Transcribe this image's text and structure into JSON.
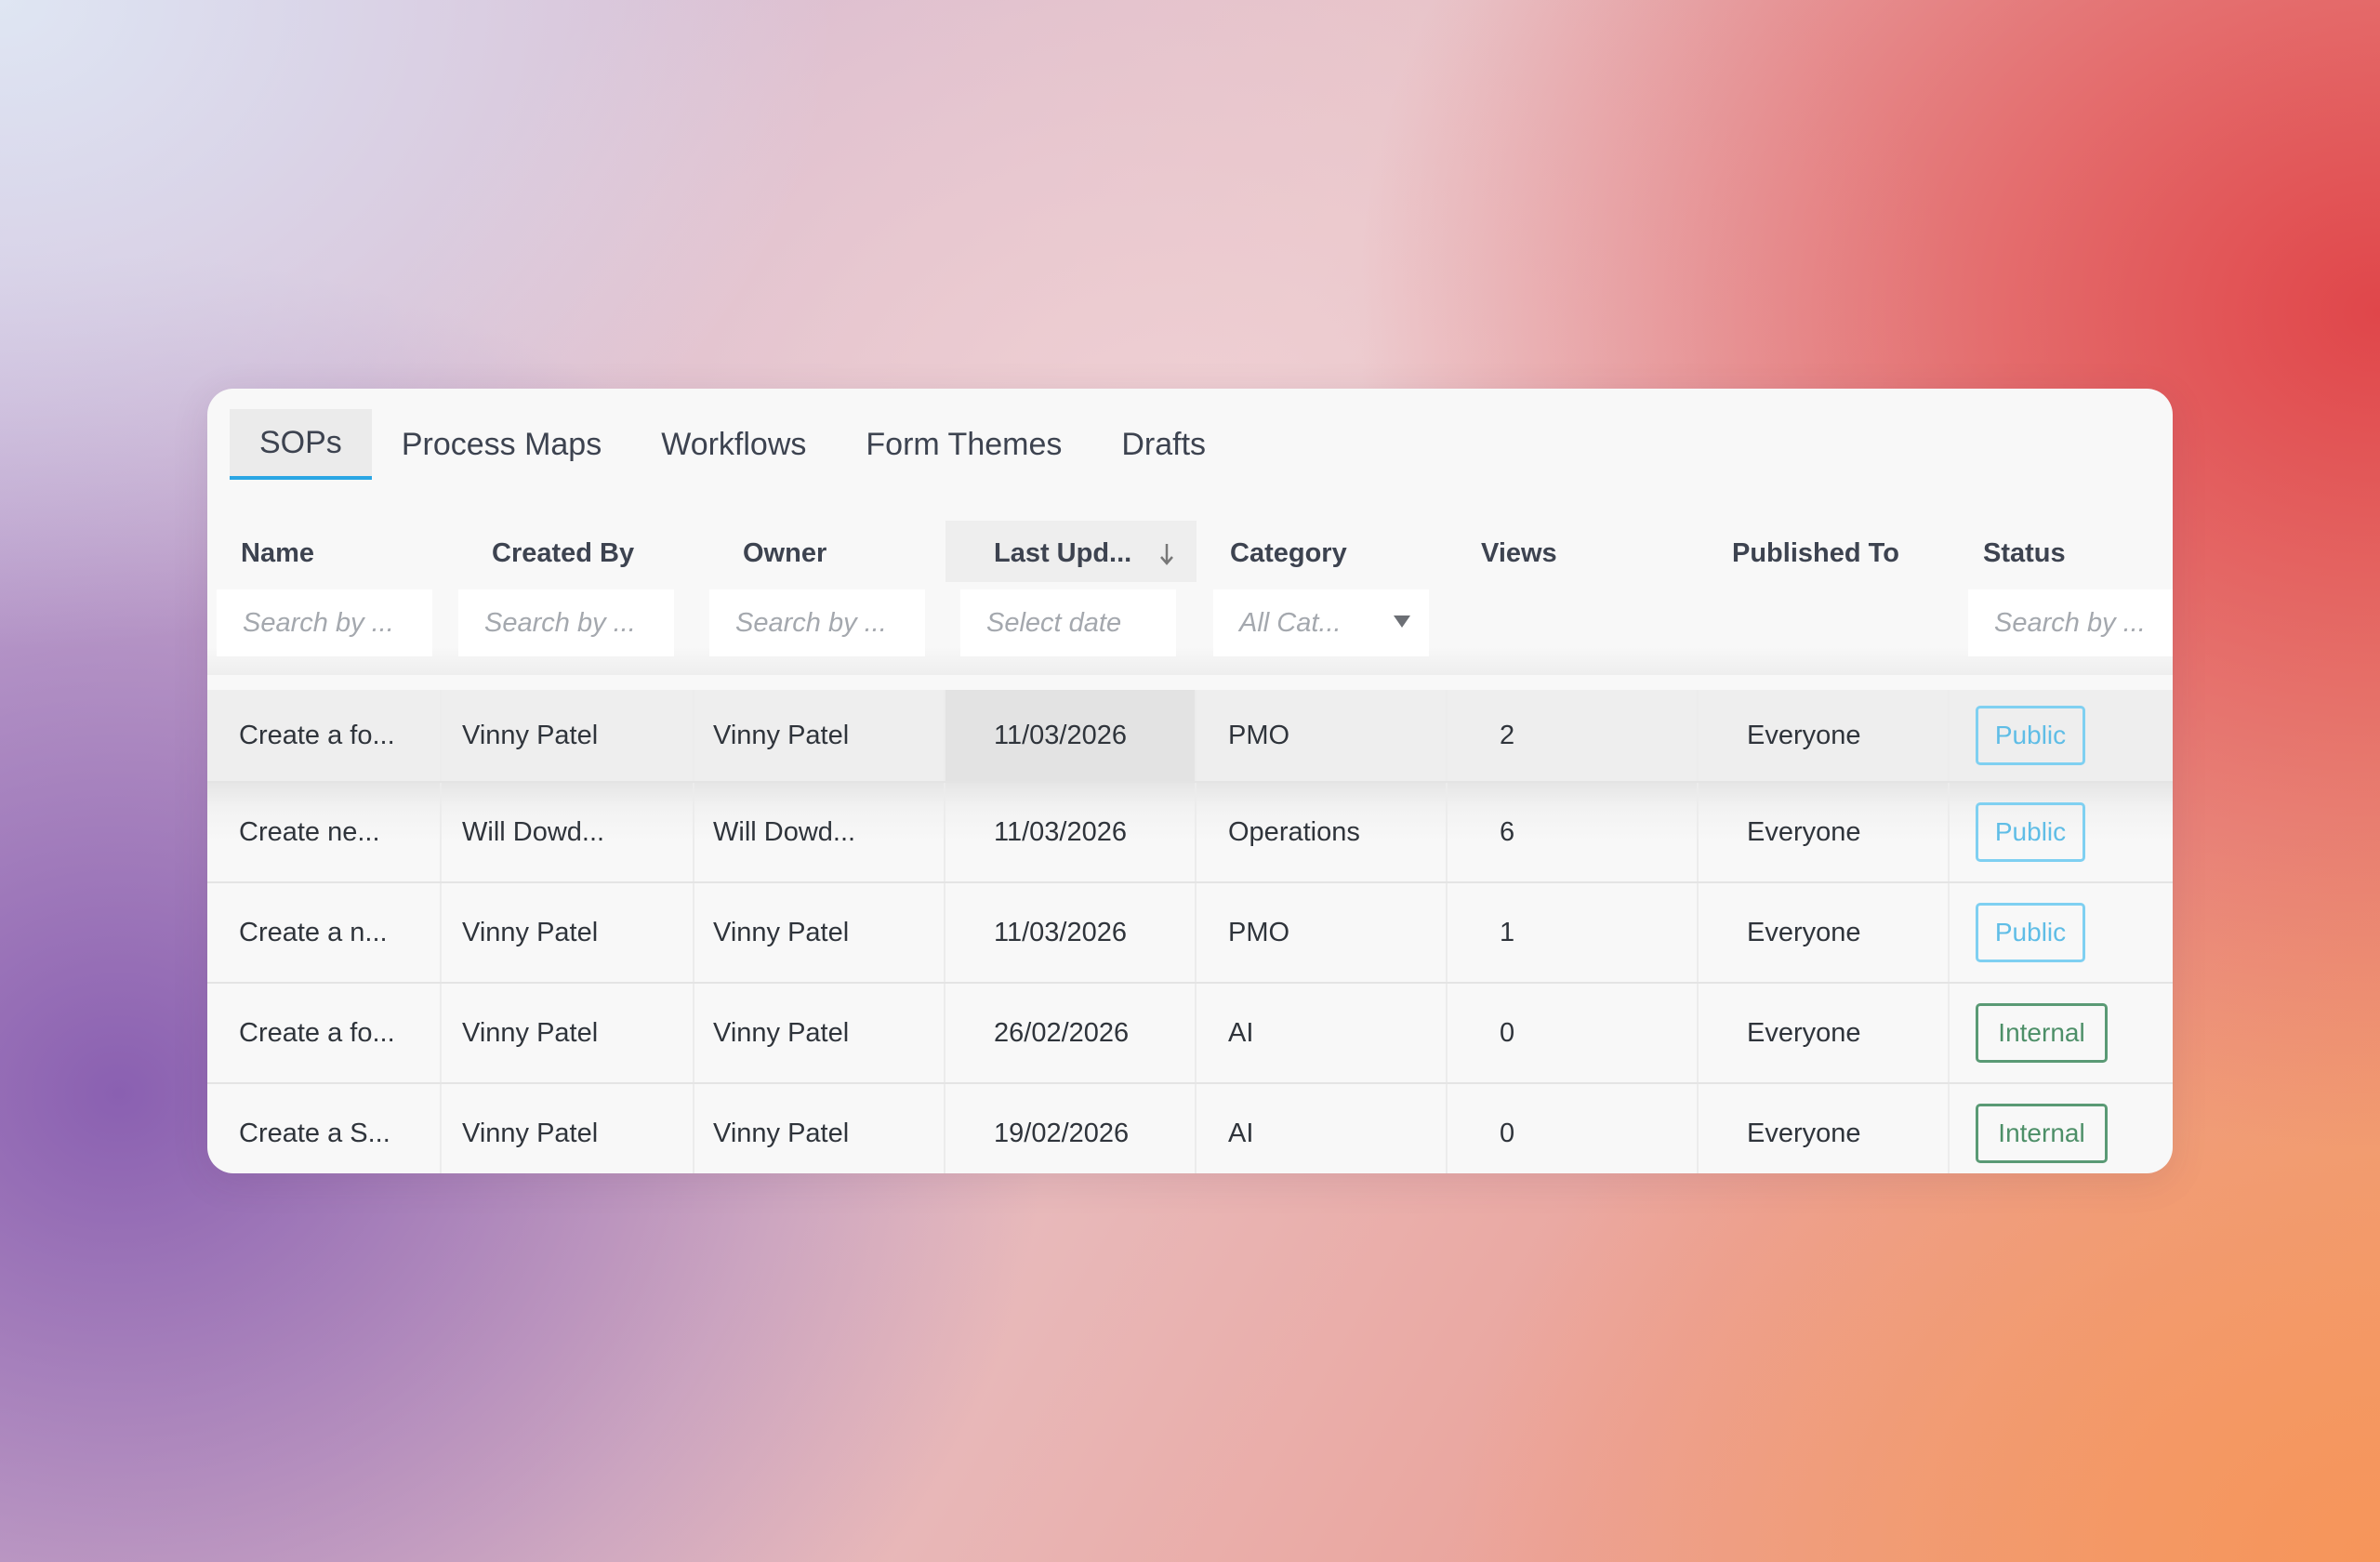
{
  "tabs": [
    {
      "label": "SOPs",
      "active": true
    },
    {
      "label": "Process Maps",
      "active": false
    },
    {
      "label": "Workflows",
      "active": false
    },
    {
      "label": "Form Themes",
      "active": false
    },
    {
      "label": "Drafts",
      "active": false
    }
  ],
  "columns": [
    "Name",
    "Created By",
    "Owner",
    "Last Upd...",
    "Category",
    "Views",
    "Published To",
    "Status"
  ],
  "sorted_column": "Last Upd...",
  "sort_icon": "arrow-down-icon",
  "filters": {
    "name": "Search by ...",
    "created_by": "Search by ...",
    "owner": "Search by ...",
    "last_updated": "Select date",
    "category": "All Cat...",
    "status": "Search by ..."
  },
  "rows": [
    {
      "name": "Create a fo...",
      "created_by": "Vinny Patel",
      "owner": "Vinny Patel",
      "last_updated": "11/03/2026",
      "category": "PMO",
      "views": "2",
      "published_to": "Everyone",
      "status": "Public"
    },
    {
      "name": "Create ne...",
      "created_by": "Will Dowd...",
      "owner": "Will Dowd...",
      "last_updated": "11/03/2026",
      "category": "Operations",
      "views": "6",
      "published_to": "Everyone",
      "status": "Public"
    },
    {
      "name": "Create a n...",
      "created_by": "Vinny Patel",
      "owner": "Vinny Patel",
      "last_updated": "11/03/2026",
      "category": "PMO",
      "views": "1",
      "published_to": "Everyone",
      "status": "Public"
    },
    {
      "name": "Create a fo...",
      "created_by": "Vinny Patel",
      "owner": "Vinny Patel",
      "last_updated": "26/02/2026",
      "category": "AI",
      "views": "0",
      "published_to": "Everyone",
      "status": "Internal"
    },
    {
      "name": "Create a S...",
      "created_by": "Vinny Patel",
      "owner": "Vinny Patel",
      "last_updated": "19/02/2026",
      "category": "AI",
      "views": "0",
      "published_to": "Everyone",
      "status": "Internal"
    }
  ],
  "colors": {
    "accent_tab": "#2aa6e4",
    "public_badge": "#7fd0f1",
    "internal_badge": "#5a9a75"
  }
}
